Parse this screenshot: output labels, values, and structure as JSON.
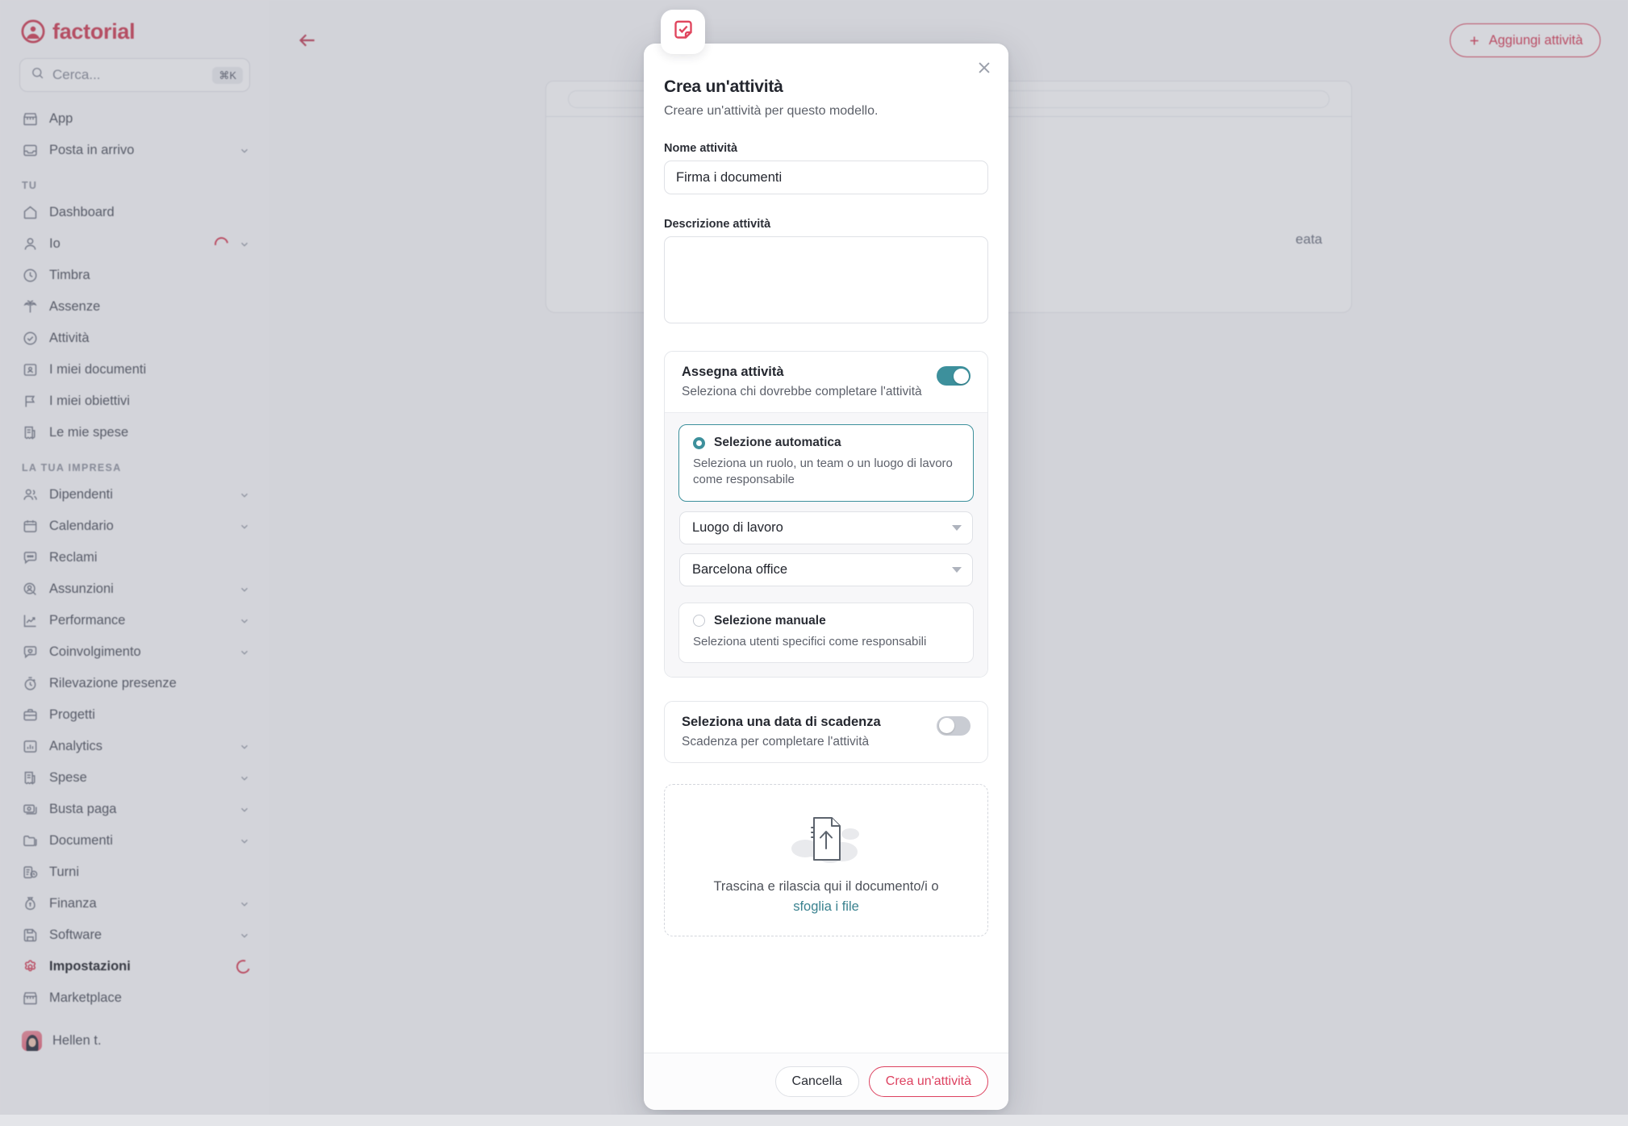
{
  "brand": {
    "name": "factorial",
    "logo_color": "#d14258"
  },
  "search": {
    "placeholder": "Cerca...",
    "shortcut": "⌘K"
  },
  "sidebar": {
    "top_items": [
      {
        "label": "App",
        "icon": "store-icon",
        "chevron": false
      },
      {
        "label": "Posta in arrivo",
        "icon": "inbox-icon",
        "chevron": true
      }
    ],
    "group_tu_label": "TU",
    "tu_items": [
      {
        "label": "Dashboard",
        "icon": "home-icon",
        "chevron": false
      },
      {
        "label": "Io",
        "icon": "user-icon",
        "chevron": true,
        "ring": true
      },
      {
        "label": "Timbra",
        "icon": "clock-icon",
        "chevron": false
      },
      {
        "label": "Assenze",
        "icon": "palm-tree-icon",
        "chevron": false
      },
      {
        "label": "Attività",
        "icon": "check-circle-icon",
        "chevron": false
      },
      {
        "label": "I miei documenti",
        "icon": "document-person-icon",
        "chevron": false
      },
      {
        "label": "I miei obiettivi",
        "icon": "flag-icon",
        "chevron": false
      },
      {
        "label": "Le mie spese",
        "icon": "receipt-icon",
        "chevron": false
      }
    ],
    "group_company_label": "LA TUA IMPRESA",
    "company_items": [
      {
        "label": "Dipendenti",
        "icon": "people-icon",
        "chevron": true
      },
      {
        "label": "Calendario",
        "icon": "calendar-icon",
        "chevron": true
      },
      {
        "label": "Reclami",
        "icon": "chat-icon",
        "chevron": false
      },
      {
        "label": "Assunzioni",
        "icon": "user-search-icon",
        "chevron": true
      },
      {
        "label": "Performance",
        "icon": "trend-up-icon",
        "chevron": true
      },
      {
        "label": "Coinvolgimento",
        "icon": "chat-heart-icon",
        "chevron": true
      },
      {
        "label": "Rilevazione presenze",
        "icon": "stopwatch-icon",
        "chevron": false
      },
      {
        "label": "Progetti",
        "icon": "briefcase-icon",
        "chevron": false
      },
      {
        "label": "Analytics",
        "icon": "bar-chart-icon",
        "chevron": true
      },
      {
        "label": "Spese",
        "icon": "receipt-icon",
        "chevron": true
      },
      {
        "label": "Busta paga",
        "icon": "money-icon",
        "chevron": true
      },
      {
        "label": "Documenti",
        "icon": "folder-icon",
        "chevron": true
      },
      {
        "label": "Turni",
        "icon": "shift-clock-icon",
        "chevron": false
      },
      {
        "label": "Finanza",
        "icon": "money-bag-icon",
        "chevron": true
      },
      {
        "label": "Software",
        "icon": "floppy-disk-icon",
        "chevron": true
      },
      {
        "label": "Impostazioni",
        "icon": "gear-icon",
        "chevron": false,
        "active": true,
        "ring": true
      },
      {
        "label": "Marketplace",
        "icon": "store-icon",
        "chevron": false
      }
    ],
    "user": {
      "label": "Hellen t.",
      "icon": "avatar"
    }
  },
  "topbar": {
    "back_icon": "arrow-left-icon",
    "add_button": {
      "label": "Aggiungi attività",
      "icon": "plus-icon"
    }
  },
  "background_panel": {
    "fragment_text": "eata"
  },
  "modal": {
    "badge_icon": "task-note-check-icon",
    "close_icon": "close-icon",
    "title": "Crea un'attività",
    "subtitle": "Creare un'attività per questo modello.",
    "name_field": {
      "label": "Nome attività",
      "value": "Firma i documenti",
      "placeholder": ""
    },
    "description_field": {
      "label": "Descrizione attività",
      "value": "",
      "placeholder": ""
    },
    "assign_card": {
      "title": "Assegna attività",
      "description": "Seleziona chi dovrebbe completare l'attività",
      "toggle_on": true,
      "toggle_color": "#3d909c",
      "options": [
        {
          "title": "Selezione automatica",
          "description": "Seleziona un ruolo, un team o un luogo di lavoro come responsabile",
          "selected": true
        },
        {
          "title": "Selezione manuale",
          "description": "Seleziona utenti specifici come responsabili",
          "selected": false
        }
      ],
      "selects": [
        {
          "name": "assignee-type-select",
          "value": "Luogo di lavoro"
        },
        {
          "name": "workplace-select",
          "value": "Barcelona office"
        }
      ]
    },
    "due_card": {
      "title": "Seleziona una data di scadenza",
      "description": "Scadenza per completare l'attività",
      "toggle_on": false
    },
    "dropzone": {
      "text": "Trascina e rilascia qui il documento/i o",
      "link": "sfoglia i file",
      "icon": "upload-document-cloud-icon",
      "link_color": "#3a828f"
    },
    "footer": {
      "cancel_label": "Cancella",
      "submit_label": "Crea un'attività",
      "accent_color": "#dd4260"
    }
  }
}
